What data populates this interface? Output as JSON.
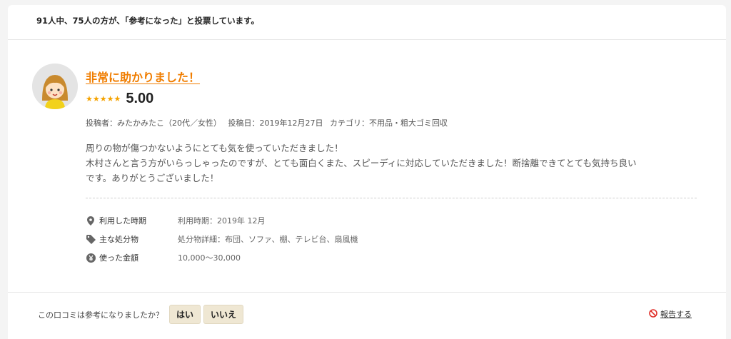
{
  "vote_summary": "91人中、75人の方が、「参考になった」と投票しています。",
  "review": {
    "title": "非常に助かりました！",
    "stars": [
      "★",
      "★",
      "★",
      "★",
      "★"
    ],
    "score": "5.00",
    "poster": "投稿者：みたかみたこ（20代／女性）",
    "posted_date": "投稿日：2019年12月27日",
    "category": "カテゴリ：不用品・粗大ゴミ回収",
    "body_lines": [
      "周りの物が傷つかないようにとても気を使っていただきました！",
      "木村さんと言う方がいらっしゃったのですが、とても面白くまた、スピーディに対応していただきました！断捨離できてとても気持ち良い",
      "です。ありがとうございました！"
    ]
  },
  "details": [
    {
      "icon": "location-pin-icon",
      "label": "利用した時期",
      "value": "利用時期：2019年 12月"
    },
    {
      "icon": "tag-icon",
      "label": "主な処分物",
      "value": "処分物詳細：布団、ソファ、棚、テレビ台、扇風機"
    },
    {
      "icon": "yen-icon",
      "label": "使った金額",
      "value": "10,000〜30,000"
    }
  ],
  "helpful": {
    "question": "この口コミは参考になりましたか？",
    "yes": "はい",
    "no": "いいえ"
  },
  "report_label": "報告する",
  "colors": {
    "accent": "#f07d00",
    "star": "#f5a300",
    "button_bg": "#efe7d3",
    "report_icon": "#e0302a"
  }
}
